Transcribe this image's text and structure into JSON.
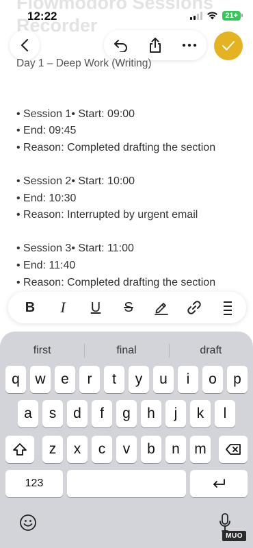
{
  "app": {
    "note_title": "Flowmodoro Sessions Recorder"
  },
  "status_bar": {
    "time": "12:22",
    "battery": "21+"
  },
  "toolbar": {
    "back_icon": "chevron-left-icon",
    "undo_icon": "undo-icon",
    "share_icon": "share-icon",
    "more_icon": "more-horizontal-icon",
    "done_icon": "checkmark-icon",
    "done_color": "#e5b321"
  },
  "note": {
    "heading": "Day 1 – Deep Work (Writing)",
    "lines": [
      "",
      "• Session 1• Start: 09:00",
      "• End: 09:45",
      "• Reason: Completed drafting the section",
      "",
      "• Session 2• Start: 10:00",
      "• End: 10:30",
      "• Reason: Interrupted by urgent email",
      "",
      "• Session 3• Start: 11:00",
      "• End: 11:40",
      "• Reason: Completed drafting the section"
    ]
  },
  "format_bar": {
    "bold": "B",
    "italic": "I",
    "underline": "U",
    "strikethrough": "S",
    "highlight_icon": "pen-icon",
    "link_icon": "link-icon",
    "list_icon": "list-icon"
  },
  "keyboard": {
    "suggestions": [
      "first",
      "final",
      "draft"
    ],
    "row1": [
      "q",
      "w",
      "e",
      "r",
      "t",
      "y",
      "u",
      "i",
      "o",
      "p"
    ],
    "row2": [
      "a",
      "s",
      "d",
      "f",
      "g",
      "h",
      "j",
      "k",
      "l"
    ],
    "row3": [
      "z",
      "x",
      "c",
      "v",
      "b",
      "n",
      "m"
    ],
    "numbers_key": "123",
    "shift_icon": "shift-icon",
    "delete_icon": "backspace-icon",
    "return_icon": "return-icon",
    "emoji_icon": "emoji-icon",
    "mic_icon": "microphone-icon"
  },
  "watermark": "MUO"
}
